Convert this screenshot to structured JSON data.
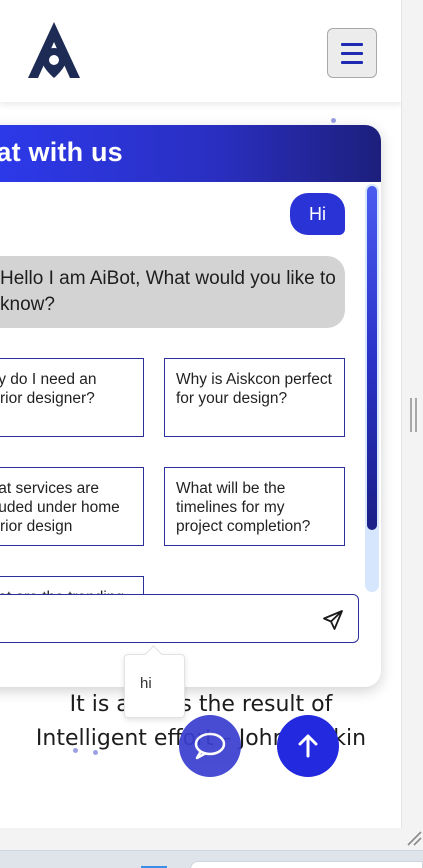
{
  "chat": {
    "title": "Chat with us",
    "user_message": "Hi",
    "bot_message": "Hello I am AiBot, What would you like to know?",
    "options": [
      "Why do I need an interior designer?",
      "Why is Aiskcon perfect for your design?",
      "What services are included under home interior design",
      "What will be the timelines for my project completion?",
      "What are the trending"
    ],
    "input_value": "",
    "input_placeholder": ""
  },
  "tooltip": {
    "text": "hi"
  },
  "quote": {
    "line1": "It is always the result of",
    "line2": "Intelligent effort – John Ruskin"
  },
  "colors": {
    "brand_navy": "#1d2b55",
    "accent_blue": "#2a33d6",
    "header_gradient_start": "#2d3bf0",
    "header_gradient_end": "#1d1f7c",
    "bot_bubble": "#d3d3d3"
  },
  "icons": {
    "logo": "a-pin-logo-icon",
    "menu": "hamburger-menu-icon",
    "send": "paper-plane-send-icon",
    "chat_fab": "speech-bubble-icon",
    "scroll_top": "arrow-up-icon"
  },
  "chat_scroll_position": 0.0
}
